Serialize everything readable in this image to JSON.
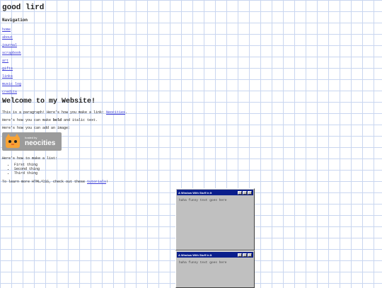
{
  "site": {
    "title": "good lird"
  },
  "nav": {
    "heading": "Navigation",
    "items": [
      "home",
      "about",
      "journal",
      "scrapbook",
      "art",
      "gifts",
      "links",
      "music log",
      "credits"
    ]
  },
  "main": {
    "heading": "Welcome to my Website!",
    "p1_prefix": "This is a paragraph! Here's how you make a link: ",
    "p1_link": "Neocities",
    "p1_suffix": ".",
    "p2_prefix": "Here's how you can make ",
    "p2_bold": "bold",
    "p2_suffix": " and italic text.",
    "p3": "Here's how you can add an image:",
    "badge_hosted": "hosted by",
    "badge_brand": "neocities",
    "p4": "Here's how to make a list:",
    "list": [
      "First thing",
      "Second thing",
      "Third thing"
    ],
    "p5_prefix": "To learn more HTML/CSS, check out these ",
    "p5_link": "tutorials",
    "p5_suffix": "!"
  },
  "windows": [
    {
      "title": "A Window With Stuff In It",
      "body": "haha funny text goes here"
    },
    {
      "title": "A Window With Stuff In It",
      "body": "haha funny text goes here"
    }
  ],
  "colors": {
    "grid": "#c9d6f0",
    "link": "#3b3bd8",
    "titlebar": "#0a1e8c",
    "window": "#c0c0c0"
  }
}
